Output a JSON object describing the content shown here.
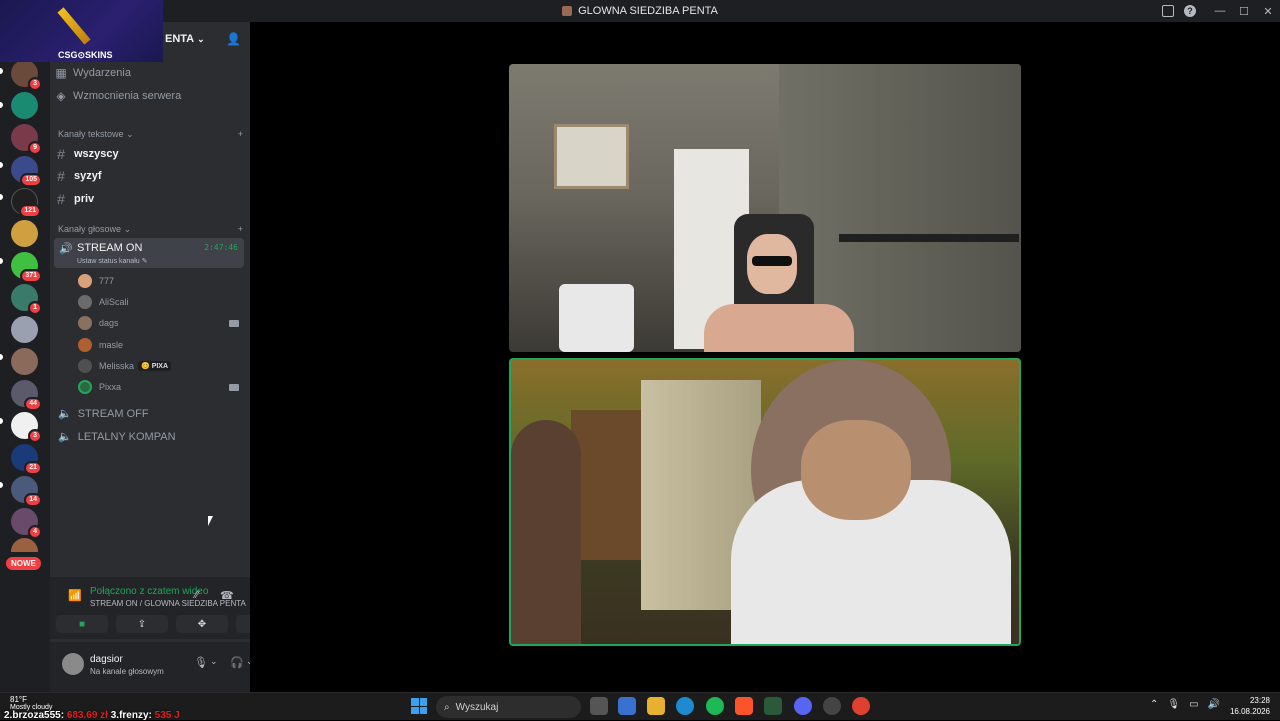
{
  "window": {
    "title": "GLOWNA SIEDZIBA PENTA",
    "minimize": "—",
    "maximize": "☐",
    "close": "✕"
  },
  "server": {
    "name": "ENTA",
    "banner_logo": "CSG⊙SKINS"
  },
  "guild_badges": [
    "3",
    "9",
    "105",
    "121",
    "371",
    "1",
    "44",
    "3",
    "21",
    "14",
    "4"
  ],
  "guilds_new_label": "NOWE",
  "sidebar": {
    "events": "Wydarzenia",
    "boosts": "Wzmocnienia serwera",
    "text_category": "Kanały tekstowe",
    "text_channels": [
      "wszyscy",
      "syzyf",
      "priv"
    ],
    "voice_category": "Kanały głosowe",
    "active_voice": {
      "name": "STREAM ON",
      "timer": "2:47:46",
      "status": "Ustaw status kanału"
    },
    "members": [
      {
        "name": "777",
        "color": "#d9a07a"
      },
      {
        "name": "AliScali",
        "color": "#6b6b6b"
      },
      {
        "name": "dags",
        "color": "#8a7060"
      },
      {
        "name": "masle",
        "color": "#b06030"
      },
      {
        "name": "Melisska",
        "color": "#505050",
        "tag": "PIXA"
      },
      {
        "name": "Pixxa",
        "color": "#2a6a40"
      }
    ],
    "other_voice": [
      "STREAM OFF",
      "LETALNY KOMPAN"
    ]
  },
  "rtc": {
    "label": "Połączono z czatem wideo",
    "sub": "STREAM ON / GLOWNA SIEDZIBA PENTA"
  },
  "user": {
    "name": "dagsior",
    "status": "Na kanale głosowym"
  },
  "taskbar": {
    "weather_temp": "81°F",
    "weather_desc": "Mostly cloudy",
    "ticker_a": "2.brzoza555:",
    "ticker_a_val": "683.69 zł",
    "ticker_b": "3.frenzy:",
    "ticker_b_val": "535 J",
    "search_placeholder": "Wyszukaj",
    "time": "23:28",
    "date": "16.08.2026"
  },
  "colors": {
    "accent_green": "#23a55a",
    "badge_red": "#f23f43"
  }
}
